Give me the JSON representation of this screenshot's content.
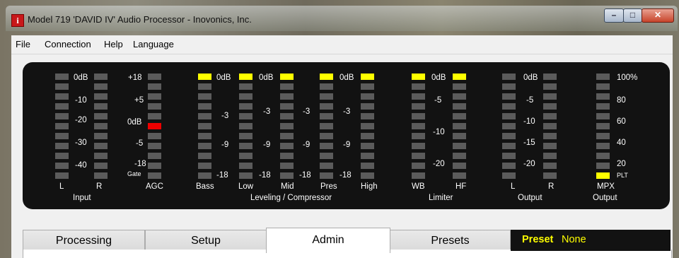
{
  "window": {
    "title": "Model 719 'DAVID IV' Audio Processor - Inovonics, Inc.",
    "app_icon_glyph": "i",
    "minimize_glyph": "–",
    "maximize_glyph": "□",
    "close_glyph": "✕"
  },
  "menu": [
    "File",
    "Connection",
    "Help",
    "Language"
  ],
  "meters": {
    "input": {
      "scale": [
        "0dB",
        "-10",
        "-20",
        "-30",
        "-40"
      ],
      "left_label": "L",
      "right_label": "R",
      "group_label": "Input",
      "left_lit_count": 0,
      "right_lit_count": 0
    },
    "agc": {
      "scale": [
        "+18",
        "+5",
        "0dB",
        "-5",
        "-18"
      ],
      "gate_label": "Gate",
      "label": "AGC",
      "active_level": "0dB",
      "active_color": "#ee0000"
    },
    "leveling_compressor": {
      "scales": [
        [
          "0dB",
          "-3",
          "-9",
          "-18"
        ],
        [
          "0dB",
          "-3",
          "-9",
          "-18"
        ],
        [
          "-3",
          "-9",
          "-18"
        ],
        [
          "0dB",
          "-3",
          "-9",
          "-18"
        ]
      ],
      "bands": [
        "Bass",
        "Low",
        "Mid",
        "Pres",
        "High"
      ],
      "lit": [
        1,
        1,
        1,
        1,
        1
      ],
      "group_label": "Leveling / Compressor"
    },
    "limiter": {
      "scale": [
        "0dB",
        "-5",
        "-10",
        "-20"
      ],
      "bands": [
        "WB",
        "HF"
      ],
      "lit": [
        1,
        1
      ],
      "group_label": "Limiter"
    },
    "output": {
      "scale": [
        "0dB",
        "-5",
        "-10",
        "-15",
        "-20"
      ],
      "left_label": "L",
      "right_label": "R",
      "group_label": "Output",
      "lit": [
        0,
        0
      ]
    },
    "mpx": {
      "scale": [
        "100%",
        "80",
        "60",
        "40",
        "20"
      ],
      "pilot_label": "PLT",
      "label": "MPX",
      "group_label": "Output",
      "pilot_on": true
    },
    "colors": {
      "lit_yellow": "#ffff00",
      "lit_red": "#ee0000",
      "off_gray": "#5b5b5b",
      "panel": "#121212"
    }
  },
  "tabs": [
    "Processing",
    "Setup",
    "Admin",
    "Presets"
  ],
  "active_tab": "Admin",
  "preset": {
    "label": "Preset",
    "value": "None"
  }
}
